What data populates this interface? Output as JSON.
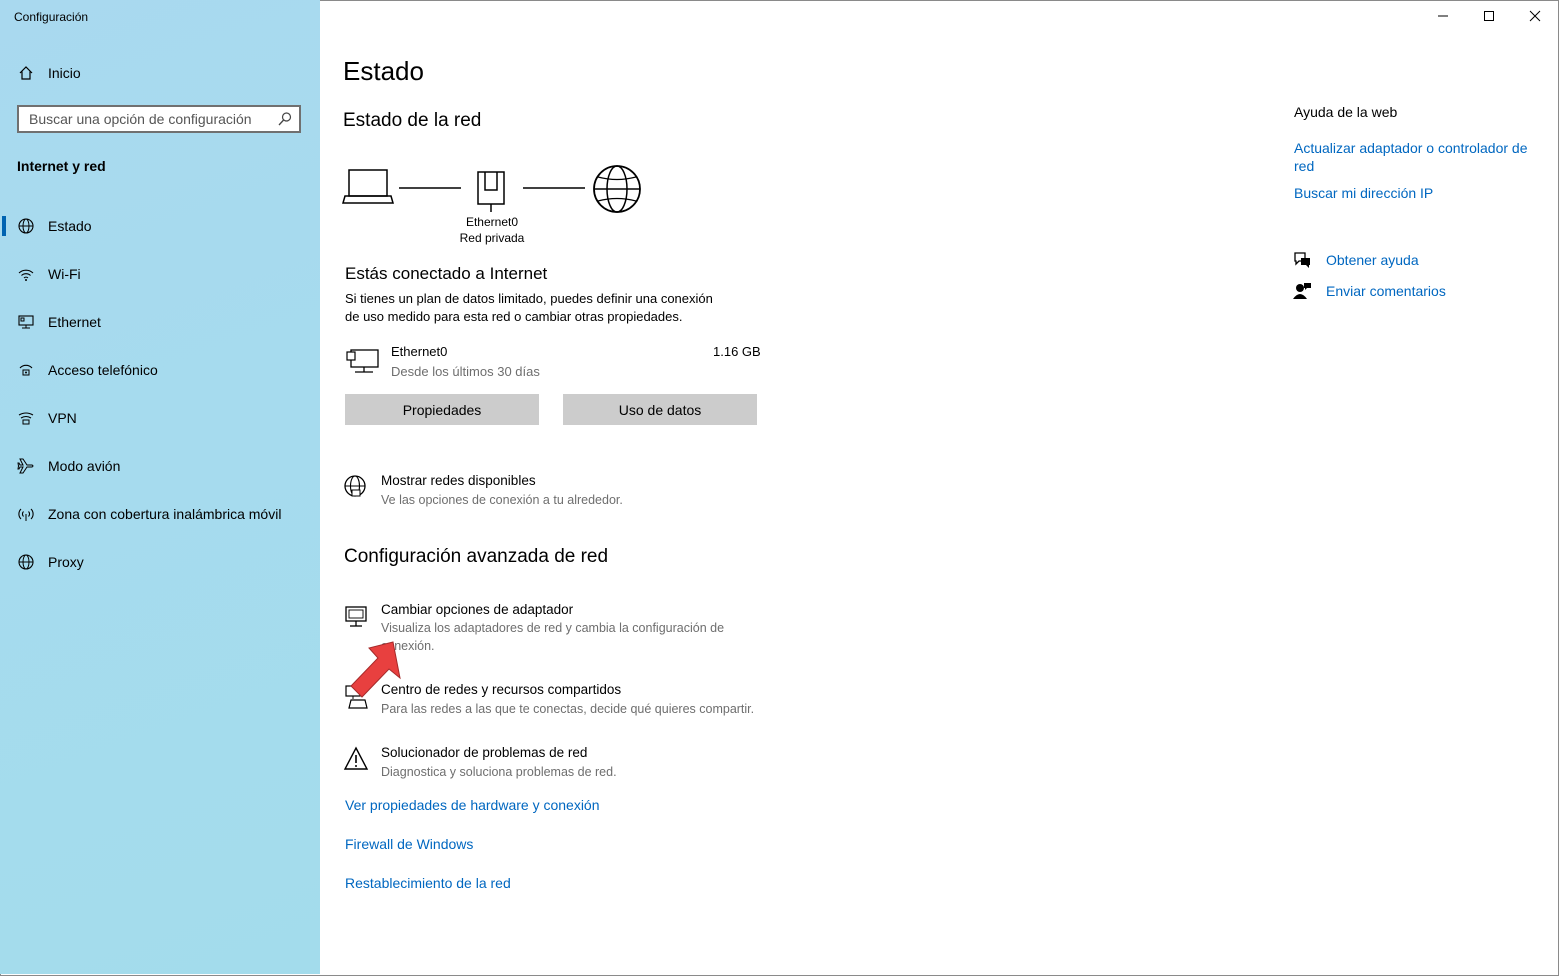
{
  "window": {
    "title": "Configuración",
    "controls": {
      "minimize": "—",
      "maximize": "☐",
      "close": "✕"
    }
  },
  "sidebar": {
    "home_label": "Inicio",
    "search_placeholder": "Buscar una opción de configuración",
    "section_heading": "Internet y red",
    "items": [
      {
        "label": "Estado",
        "icon": "globe-status-icon",
        "active": true
      },
      {
        "label": "Wi-Fi",
        "icon": "wifi-icon"
      },
      {
        "label": "Ethernet",
        "icon": "ethernet-icon"
      },
      {
        "label": "Acceso telefónico",
        "icon": "dialup-icon"
      },
      {
        "label": "VPN",
        "icon": "vpn-icon"
      },
      {
        "label": "Modo avión",
        "icon": "airplane-icon"
      },
      {
        "label": "Zona con cobertura inalámbrica móvil",
        "icon": "hotspot-icon"
      },
      {
        "label": "Proxy",
        "icon": "globe-icon"
      }
    ]
  },
  "main": {
    "page_title": "Estado",
    "network_status_heading": "Estado de la red",
    "diagram": {
      "adapter_name": "Ethernet0",
      "network_type": "Red privada"
    },
    "connected_heading": "Estás conectado a Internet",
    "connected_desc_line1": "Si tienes un plan de datos limitado, puedes definir una conexión",
    "connected_desc_line2": "de uso medido para esta red o cambiar otras propiedades.",
    "usage": {
      "name": "Ethernet0",
      "period": "Desde los últimos 30 días",
      "amount": "1.16 GB"
    },
    "buttons": {
      "properties": "Propiedades",
      "data_usage": "Uso de datos"
    },
    "show_networks": {
      "title": "Mostrar redes disponibles",
      "desc": "Ve las opciones de conexión a tu alrededor."
    },
    "advanced_heading": "Configuración avanzada de red",
    "advanced_items": [
      {
        "title": "Cambiar opciones de adaptador",
        "desc_line1": "Visualiza los adaptadores de red y cambia la configuración de",
        "desc_line2": "conexión."
      },
      {
        "title": "Centro de redes y recursos compartidos",
        "desc_line1": "Para las redes a las que te conectas, decide qué quieres compartir."
      },
      {
        "title": "Solucionador de problemas de red",
        "desc_line1": "Diagnostica y soluciona problemas de red."
      }
    ],
    "links": [
      "Ver propiedades de hardware y conexión",
      "Firewall de Windows",
      "Restablecimiento de la red"
    ]
  },
  "right_panel": {
    "help_heading": "Ayuda de la web",
    "help_link1_line1": "Actualizar adaptador o controlador de",
    "help_link1_line2": "red",
    "help_link2": "Buscar mi dirección IP",
    "get_help": "Obtener ayuda",
    "send_feedback": "Enviar comentarios"
  },
  "colors": {
    "accent": "#0067c0",
    "sidebar_bg": "#a8d9ee",
    "annotation_arrow": "#e8403f"
  }
}
